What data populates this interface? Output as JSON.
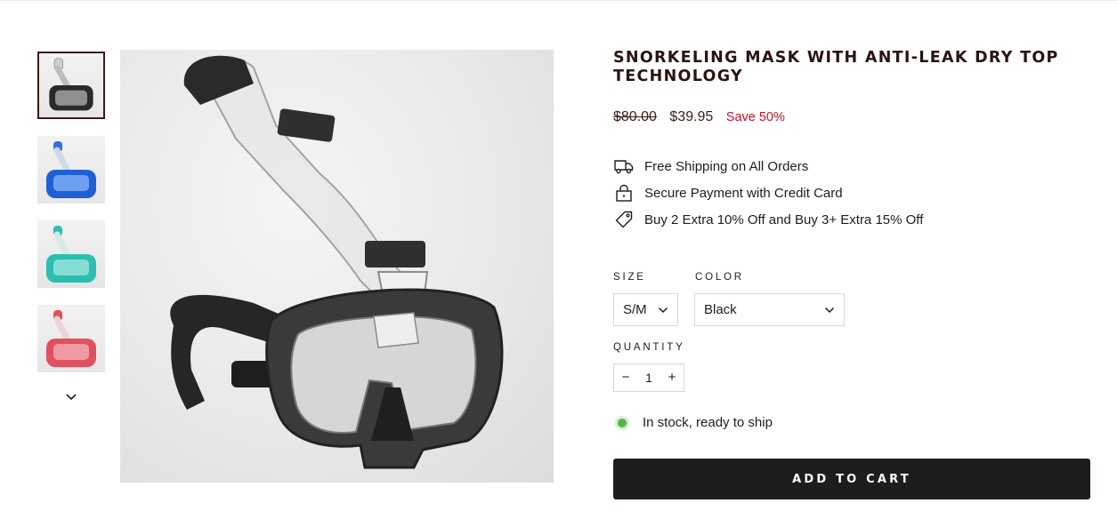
{
  "product": {
    "title": "SNORKELING MASK WITH ANTI-LEAK DRY TOP TECHNOLOGY",
    "price_compare": "$80.00",
    "price_current": "$39.95",
    "price_save": "Save 50%"
  },
  "perks": [
    {
      "icon": "truck-icon",
      "text": "Free Shipping on All Orders"
    },
    {
      "icon": "lock-icon",
      "text": "Secure Payment with Credit Card"
    },
    {
      "icon": "tag-icon",
      "text": "Buy 2 Extra 10% Off and Buy 3+ Extra 15% Off"
    }
  ],
  "options": {
    "size_label": "SIZE",
    "size_value": "S/M",
    "color_label": "COLOR",
    "color_value": "Black",
    "quantity_label": "QUANTITY",
    "quantity_value": "1",
    "minus": "−",
    "plus": "+"
  },
  "stock_text": "In stock, ready to ship",
  "add_to_cart": "ADD TO CART",
  "thumbnails": [
    {
      "name": "thumbnail-black",
      "color": "#2a2a2a",
      "active": true
    },
    {
      "name": "thumbnail-blue",
      "color": "#1f5fd6",
      "active": false
    },
    {
      "name": "thumbnail-teal",
      "color": "#2cbfb0",
      "active": false
    },
    {
      "name": "thumbnail-red",
      "color": "#e0505e",
      "active": false
    }
  ],
  "colors": {
    "title": "#2b1410",
    "sale": "#c8102e",
    "in_stock": "#55b64d",
    "button_bg": "#1c1d1d",
    "active_thumb_border": "#3b1c14"
  }
}
